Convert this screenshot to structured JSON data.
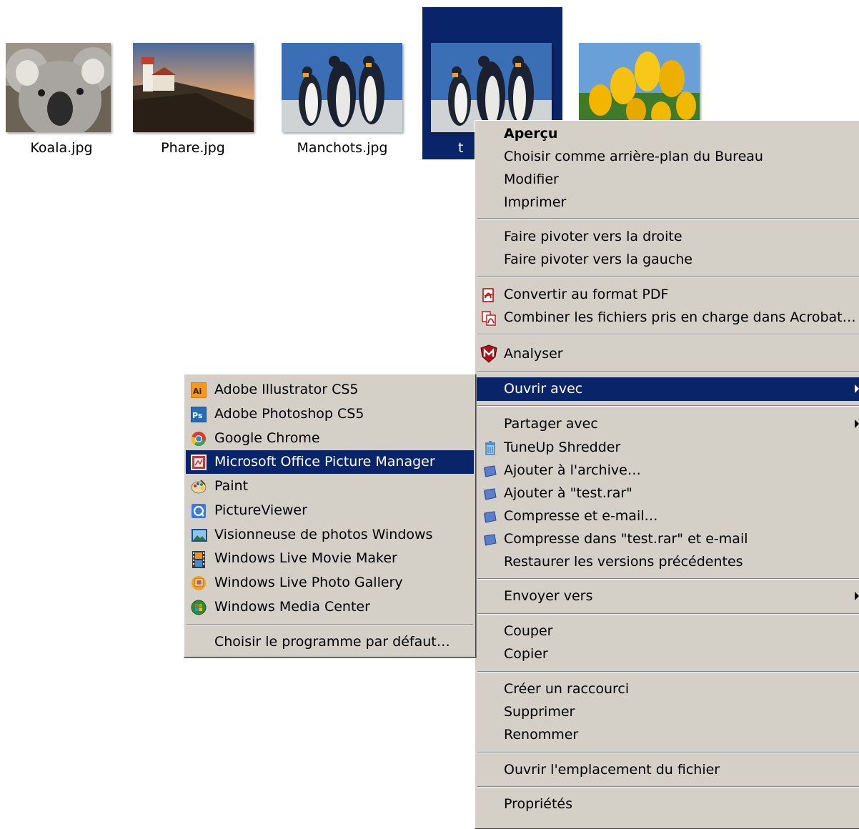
{
  "files": [
    {
      "name": "Koala.jpg"
    },
    {
      "name": "Phare.jpg"
    },
    {
      "name": "Manchots.jpg"
    },
    {
      "name": "t"
    },
    {
      "name": ""
    }
  ],
  "context_menu": {
    "items": {
      "apercu": "Aperçu",
      "wallpaper": "Choisir comme arrière-plan du Bureau",
      "modifier": "Modifier",
      "imprimer": "Imprimer",
      "rotate_right": "Faire pivoter vers la droite",
      "rotate_left": "Faire pivoter vers la gauche",
      "convert_pdf": "Convertir au format PDF",
      "combine_acrobat": "Combiner les fichiers pris en charge dans Acrobat…",
      "analyser": "Analyser",
      "ouvrir_avec": "Ouvrir avec",
      "partager_avec": "Partager avec",
      "tuneup": "TuneUp Shredder",
      "add_archive": "Ajouter à l'archive…",
      "add_rar": "Ajouter à \"test.rar\"",
      "compress_email": "Compresse et e-mail…",
      "compress_rar_email": "Compresse dans \"test.rar\" et e-mail",
      "restore": "Restaurer les versions précédentes",
      "envoyer_vers": "Envoyer vers",
      "couper": "Couper",
      "copier": "Copier",
      "raccourci": "Créer un raccourci",
      "supprimer": "Supprimer",
      "renommer": "Renommer",
      "ouvrir_emplacement": "Ouvrir l'emplacement du fichier",
      "proprietes": "Propriétés"
    }
  },
  "open_with_menu": {
    "items": {
      "illustrator": "Adobe Illustrator CS5",
      "photoshop": "Adobe Photoshop CS5",
      "chrome": "Google Chrome",
      "picture_manager": "Microsoft Office Picture Manager",
      "paint": "Paint",
      "pictureviewer": "PictureViewer",
      "visionneuse": "Visionneuse de photos Windows",
      "movie_maker": "Windows Live Movie Maker",
      "photo_gallery": "Windows Live Photo Gallery",
      "media_center": "Windows Media Center",
      "default_program": "Choisir le programme par défaut…"
    }
  },
  "colors": {
    "selection": "#0a246a",
    "menu_bg": "#d4d0c8"
  },
  "icons": {
    "convert_pdf": "acrobat-pdf-icon",
    "combine_acrobat": "acrobat-combine-icon",
    "analyser": "mcafee-shield-icon",
    "tuneup": "trash-bin-icon",
    "winrar": "winrar-book-icon"
  }
}
